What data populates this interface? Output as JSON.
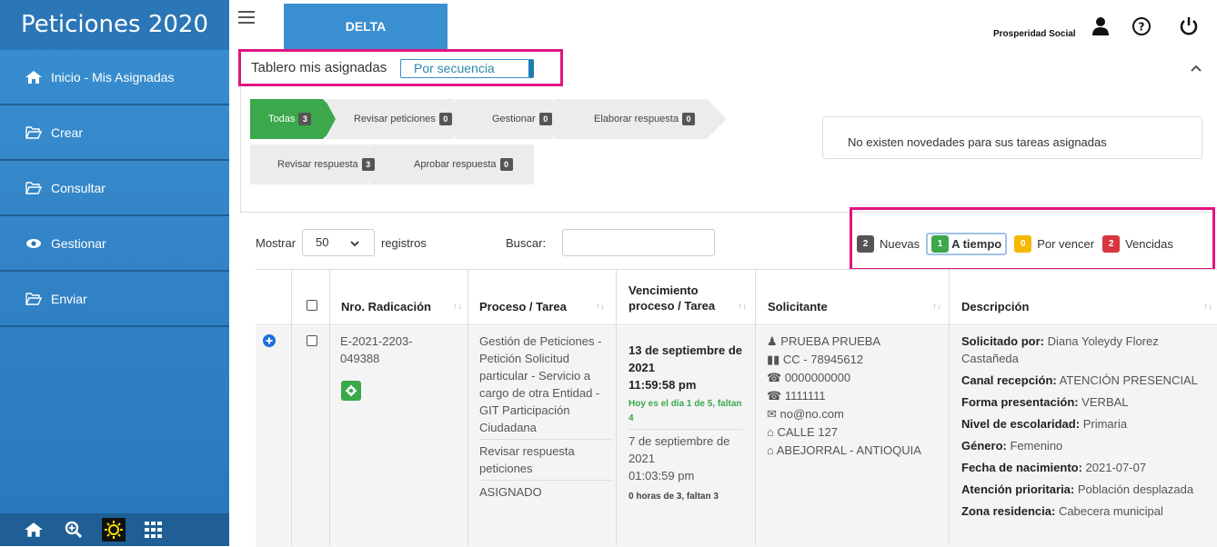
{
  "sidebar": {
    "brand": "Peticiones 2020",
    "items": [
      {
        "label": "Inicio - Mis Asignadas",
        "icon": "home-icon"
      },
      {
        "label": "Crear",
        "icon": "folder-open-icon"
      },
      {
        "label": "Consultar",
        "icon": "folder-open-icon"
      },
      {
        "label": "Gestionar",
        "icon": "eye-icon"
      },
      {
        "label": "Enviar",
        "icon": "folder-open-icon"
      }
    ],
    "bottom_icons": [
      "home-icon",
      "zoom-in-icon",
      "sun-icon",
      "grid-icon"
    ]
  },
  "topbar": {
    "tab": "DELTA",
    "org": "Prosperidad Social"
  },
  "board": {
    "title": "Tablero mis asignadas",
    "mode": "Por secuencia",
    "steps": [
      {
        "label": "Todas",
        "count": "3"
      },
      {
        "label": "Revisar peticiones",
        "count": "0"
      },
      {
        "label": "Gestionar",
        "count": "0"
      },
      {
        "label": "Elaborar respuesta",
        "count": "0"
      },
      {
        "label": "Revisar respuesta",
        "count": "3"
      },
      {
        "label": "Aprobar respuesta",
        "count": "0"
      }
    ],
    "novedades": "No existen novedades para sus tareas asignadas"
  },
  "controls": {
    "show_label": "Mostrar",
    "page_size": "50",
    "records_label": "registros",
    "search_label": "Buscar:",
    "search_value": ""
  },
  "legend": {
    "nuevas_count": "2",
    "nuevas": "Nuevas",
    "atiempo_count": "1",
    "atiempo": "A tiempo",
    "porvencer_count": "0",
    "porvencer": "Por vencer",
    "vencidas_count": "2",
    "vencidas": "Vencidas",
    "colors": {
      "nuevas": "#555555",
      "atiempo": "#3aa84b",
      "porvencer": "#f5b800",
      "vencidas": "#d9363e"
    }
  },
  "table": {
    "headers": [
      "Nro. Radicación",
      "Proceso / Tarea",
      "Vencimiento proceso / Tarea",
      "Solicitante",
      "Descripción"
    ],
    "row": {
      "radicacion": "E-2021-2203-049388",
      "proceso": "Gestión de Peticiones - Petición Solicitud particular - Servicio a cargo de otra Entidad - GIT Participación Ciudadana",
      "tarea": "Revisar respuesta peticiones",
      "estado": "ASIGNADO",
      "venc_proceso_fecha": "13 de septiembre de 2021",
      "venc_proceso_hora": "11:59:58 pm",
      "venc_proceso_nota": "Hoy es el día 1 de 5, faltan 4",
      "venc_tarea_fecha": "7 de septiembre de 2021",
      "venc_tarea_hora": "01:03:59 pm",
      "venc_tarea_nota": "0 horas de 3, faltan 3",
      "solicitante": [
        "PRUEBA PRUEBA",
        "CC - 78945612",
        "0000000000",
        "1111111",
        "no@no.com",
        "CALLE 127",
        "ABEJORRAL - ANTIOQUIA"
      ],
      "descripcion": [
        {
          "k": "Solicitado por:",
          "v": "Diana Yoleydy Florez Castañeda"
        },
        {
          "k": "Canal recepción:",
          "v": "ATENCIÓN PRESENCIAL"
        },
        {
          "k": "Forma presentación:",
          "v": "VERBAL"
        },
        {
          "k": "Nivel de escolaridad:",
          "v": "Primaria"
        },
        {
          "k": "Género:",
          "v": "Femenino"
        },
        {
          "k": "Fecha de nacimiento:",
          "v": "2021-07-07"
        },
        {
          "k": "Atención prioritaria:",
          "v": "Población desplazada"
        },
        {
          "k": "Zona residencia:",
          "v": "Cabecera municipal"
        }
      ]
    }
  }
}
